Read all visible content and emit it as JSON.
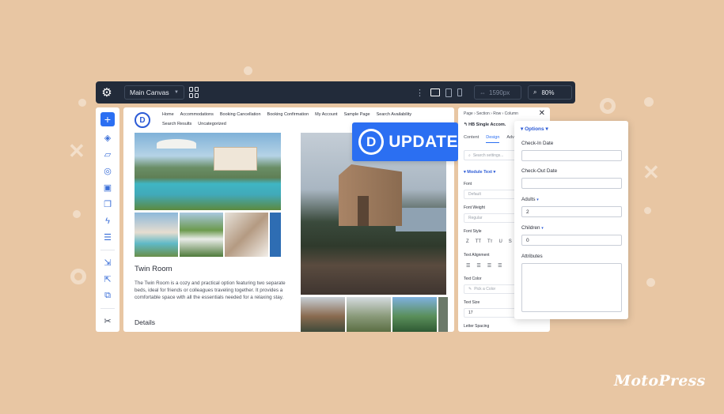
{
  "toolbar": {
    "canvas_select": "Main Canvas",
    "width_value": "1590px",
    "zoom_value": "80%"
  },
  "site": {
    "logo_letter": "D",
    "nav": [
      "Home",
      "Accommodations",
      "Booking Cancellation",
      "Booking Confirmation",
      "My Account",
      "Sample Page",
      "Search Availability",
      "Search Results",
      "Uncategorized"
    ],
    "room_title": "Twin Room",
    "room_description": "The Twin Room is a cozy and practical option featuring two separate beds, ideal for friends or colleagues traveling together. It provides a comfortable space with all the essentials needed for a relaxing stay.",
    "details_heading": "Details"
  },
  "badge": {
    "letter": "D",
    "label": "UPDATE"
  },
  "settings": {
    "breadcrumb": "Page › Section › Row › Column",
    "module_title": "HB Single Accom.",
    "tabs": [
      "Content",
      "Design",
      "Adv"
    ],
    "search_placeholder": "Search settings...",
    "section": "Module Text",
    "font_label": "Font",
    "font_value": "Default",
    "font_weight_label": "Font Weight",
    "font_weight_value": "Regular",
    "font_style_label": "Font Style",
    "font_style_icons": [
      "Z",
      "TT",
      "Tт",
      "U",
      "S"
    ],
    "text_alignment_label": "Text Alignment",
    "text_color_label": "Text Color",
    "text_color_placeholder": "Pick a Color",
    "text_size_label": "Text Size",
    "text_size_value": "17",
    "letter_spacing_label": "Letter Spacing"
  },
  "options": {
    "heading": "Options",
    "checkin_label": "Check-In Date",
    "checkout_label": "Check-Out Date",
    "adults_label": "Adults",
    "adults_value": "2",
    "children_label": "Children",
    "children_value": "0",
    "attributes_label": "Attributes"
  },
  "brand": "MotoPress",
  "colors": {
    "accent": "#2b6ff2",
    "background": "#e8c6a3",
    "toolbar": "#222b3a"
  }
}
